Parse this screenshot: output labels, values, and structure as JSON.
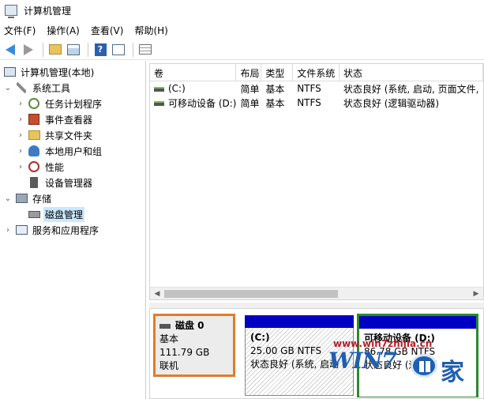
{
  "window": {
    "title": "计算机管理"
  },
  "menu": [
    "文件(F)",
    "操作(A)",
    "查看(V)",
    "帮助(H)"
  ],
  "toolbar": {
    "help_glyph": "?"
  },
  "tree": {
    "root": "计算机管理(本地)",
    "system_tools": "系统工具",
    "task_scheduler": "任务计划程序",
    "event_viewer": "事件查看器",
    "shared_folders": "共享文件夹",
    "local_users": "本地用户和组",
    "performance": "性能",
    "device_manager": "设备管理器",
    "storage": "存储",
    "disk_management": "磁盘管理",
    "services_apps": "服务和应用程序"
  },
  "columns": [
    "卷",
    "布局",
    "类型",
    "文件系统",
    "状态"
  ],
  "volumes": [
    {
      "name": "(C:)",
      "layout": "简单",
      "type": "基本",
      "fs": "NTFS",
      "status": "状态良好 (系统, 启动, 页面文件,"
    },
    {
      "name": "可移动设备 (D:)",
      "layout": "简单",
      "type": "基本",
      "fs": "NTFS",
      "status": "状态良好 (逻辑驱动器)"
    }
  ],
  "disk": {
    "name": "磁盘 0",
    "kind": "基本",
    "size": "111.79 GB",
    "state": "联机"
  },
  "partitions": {
    "c": {
      "name": "(C:)",
      "size": "25.00 GB NTFS",
      "status": "状态良好 (系统, 启动"
    },
    "d": {
      "name": "可移动设备 (D:)",
      "size": "86.78 GB NTFS",
      "status": "状态良好 (逻辑驱"
    }
  },
  "watermark": {
    "url": "www.win7zhijia.cn",
    "logo": "WIN7",
    "jia": "家"
  },
  "colors": {
    "highlight_orange": "#e07c2c",
    "highlight_green": "#2a8a2a",
    "partition_bar": "#0000c4",
    "selected_bg": "#cce8ff"
  }
}
